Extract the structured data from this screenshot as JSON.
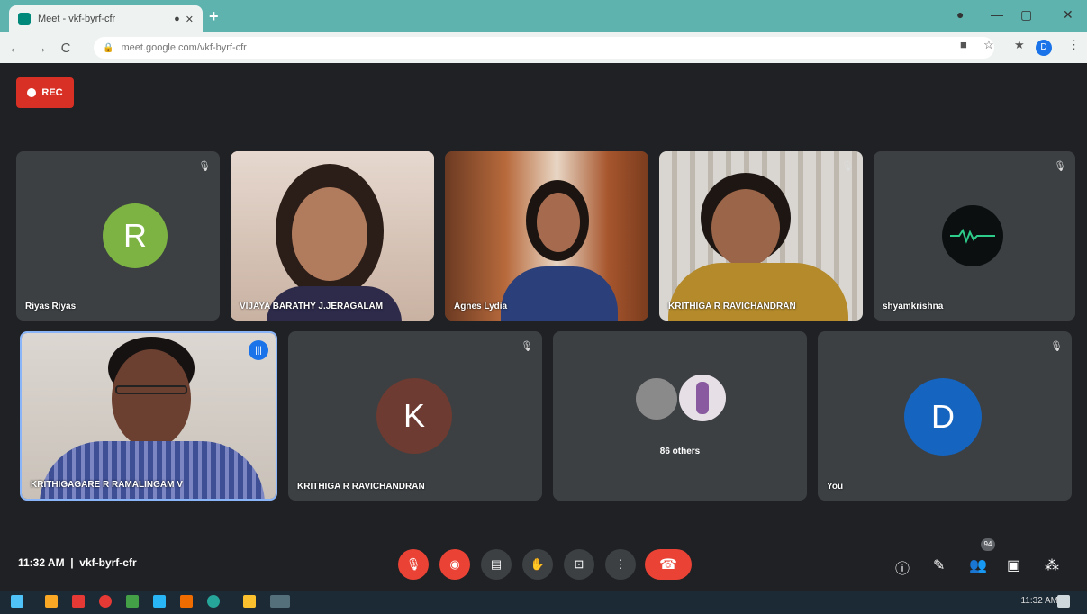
{
  "browser": {
    "tab_title": "Meet - vkf-byrf-cfr",
    "url": "meet.google.com/vkf-byrf-cfr",
    "profile_initial": "D"
  },
  "rec_label": "REC",
  "participants": [
    {
      "name": "Riyas Riyas",
      "initial": "R",
      "avatar_color": "#7cb342"
    },
    {
      "name": "VIJAYA BARATHY J.JERAGALAM"
    },
    {
      "name": "Agnes Lydia"
    },
    {
      "name": "KRITHIGA R RAVICHANDRAN"
    },
    {
      "name": "shyamkrishna"
    },
    {
      "name": "KRITHIGAGARE R RAMALINGAM V"
    },
    {
      "name": "KRITHIGA R RAVICHANDRAN",
      "initial": "K",
      "avatar_color": "#6d3b31"
    },
    {
      "name": "86 others"
    },
    {
      "name": "You",
      "initial": "D",
      "avatar_color": "#1565c0"
    }
  ],
  "meeting": {
    "time": "11:32 AM",
    "code": "vkf-byrf-cfr",
    "participant_count": "94"
  },
  "taskbar": {
    "clock": "11:32 AM"
  },
  "icons": [
    "search-icon",
    "mic-off-icon",
    "cam-off-icon",
    "captions-icon",
    "raise-hand-icon",
    "present-icon",
    "more-icon",
    "end-call-icon",
    "info-icon",
    "people-icon",
    "chat-icon",
    "activities-icon"
  ]
}
